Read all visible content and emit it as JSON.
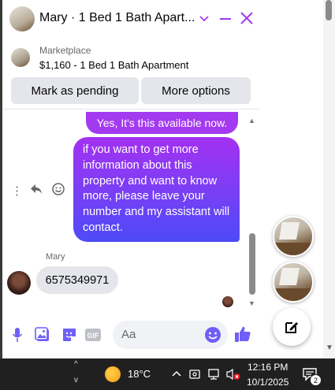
{
  "header": {
    "title": "Mary · 1 Bed 1 Bath Apart...",
    "accent_color": "#a33af0"
  },
  "marketplace": {
    "label": "Marketplace",
    "item": "$1,160 - 1 Bed 1 Bath Apartment",
    "pending_button": "Mark as pending",
    "more_button": "More options"
  },
  "messages": {
    "outgoing_1": "Yes, It's this available now.",
    "outgoing_2": "if you want to get more information about this property and want to know more, please leave your number and my assistant will contact.",
    "sender_name": "Mary",
    "incoming_1": "6575349971"
  },
  "composer": {
    "placeholder": "Aa",
    "icons": [
      "microphone-icon",
      "photo-icon",
      "sticker-icon",
      "gif-icon",
      "emoji-icon",
      "thumbs-up-icon"
    ],
    "gif_label": "GIF"
  },
  "taskbar": {
    "temperature": "18°C",
    "time": "12:16 PM",
    "date": "10/1/2025",
    "notification_count": "2"
  }
}
